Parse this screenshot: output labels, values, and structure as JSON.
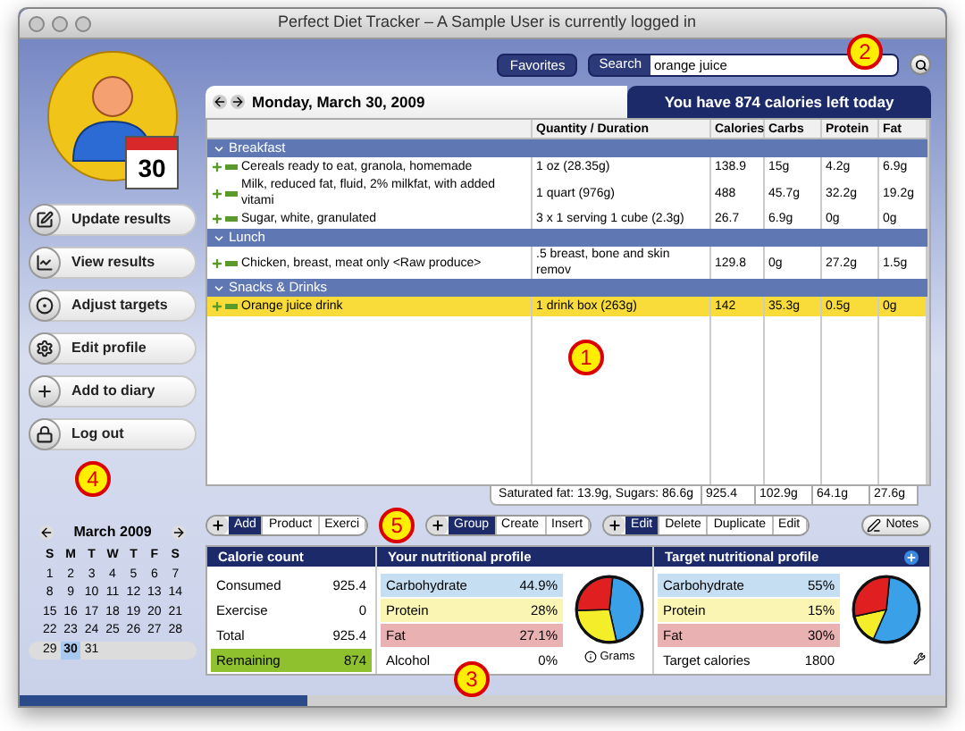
{
  "window": {
    "title": "Perfect Diet Tracker – A Sample User is currently logged in"
  },
  "calendar_badge": {
    "day": "30"
  },
  "toolbar": {
    "favorites": "Favorites",
    "search_label": "Search",
    "search_value": "orange juice"
  },
  "date_bar": {
    "date": "Monday, March 30, 2009",
    "banner": "You have 874 calories left today"
  },
  "table": {
    "columns": [
      "Quantity / Duration",
      "Calories",
      "Carbs",
      "Protein",
      "Fat"
    ],
    "groups": [
      {
        "name": "Breakfast",
        "rows": [
          {
            "food": "Cereals ready to eat, granola, homemade",
            "quantity": "1 oz (28.35g)",
            "calories": "138.9",
            "carbs": "15g",
            "protein": "4.2g",
            "fat": "6.9g",
            "selected": false
          },
          {
            "food": "Milk, reduced fat, fluid, 2% milkfat, with added vitami",
            "quantity": "1 quart (976g)",
            "calories": "488",
            "carbs": "45.7g",
            "protein": "32.2g",
            "fat": "19.2g",
            "selected": false
          },
          {
            "food": "Sugar, white, granulated",
            "quantity": "3 x 1 serving 1 cube (2.3g)",
            "calories": "26.7",
            "carbs": "6.9g",
            "protein": "0g",
            "fat": "0g",
            "selected": false
          }
        ]
      },
      {
        "name": "Lunch",
        "rows": [
          {
            "food": "Chicken, breast, meat only <Raw produce>",
            "quantity": ".5 breast, bone and skin remov",
            "calories": "129.8",
            "carbs": "0g",
            "protein": "27.2g",
            "fat": "1.5g",
            "selected": false
          }
        ]
      },
      {
        "name": "Snacks & Drinks",
        "rows": [
          {
            "food": "Orange juice drink",
            "quantity": "1 drink box (263g)",
            "calories": "142",
            "carbs": "35.3g",
            "protein": "0.5g",
            "fat": "0g",
            "selected": true
          }
        ]
      }
    ],
    "footer": {
      "summary": "Saturated fat: 13.9g, Sugars: 86.6g",
      "calories": "925.4",
      "carbs": "102.9g",
      "protein": "64.1g",
      "fat": "27.6g"
    }
  },
  "sidebar": {
    "buttons": [
      {
        "label": "Update results"
      },
      {
        "label": "View results"
      },
      {
        "label": "Adjust targets"
      },
      {
        "label": "Edit profile"
      },
      {
        "label": "Add to diary"
      },
      {
        "label": "Log out"
      }
    ]
  },
  "calendar": {
    "month": "March 2009",
    "weekdays": [
      "S",
      "M",
      "T",
      "W",
      "T",
      "F",
      "S"
    ],
    "weeks": [
      [
        {
          "day": "1",
          "selected": false
        },
        {
          "day": "2",
          "selected": false
        },
        {
          "day": "3",
          "selected": false
        },
        {
          "day": "4",
          "selected": false
        },
        {
          "day": "5",
          "selected": false
        },
        {
          "day": "6",
          "selected": false
        },
        {
          "day": "7",
          "selected": false
        }
      ],
      [
        {
          "day": "8",
          "selected": false
        },
        {
          "day": "9",
          "selected": false
        },
        {
          "day": "10",
          "selected": false
        },
        {
          "day": "11",
          "selected": false
        },
        {
          "day": "12",
          "selected": false
        },
        {
          "day": "13",
          "selected": false
        },
        {
          "day": "14",
          "selected": false
        }
      ],
      [
        {
          "day": "15",
          "selected": false
        },
        {
          "day": "16",
          "selected": false
        },
        {
          "day": "17",
          "selected": false
        },
        {
          "day": "18",
          "selected": false
        },
        {
          "day": "19",
          "selected": false
        },
        {
          "day": "20",
          "selected": false
        },
        {
          "day": "21",
          "selected": false
        }
      ],
      [
        {
          "day": "22",
          "selected": false
        },
        {
          "day": "23",
          "selected": false
        },
        {
          "day": "24",
          "selected": false
        },
        {
          "day": "25",
          "selected": false
        },
        {
          "day": "26",
          "selected": false
        },
        {
          "day": "27",
          "selected": false
        },
        {
          "day": "28",
          "selected": false
        }
      ],
      [
        {
          "day": "29",
          "selected": false
        },
        {
          "day": "30",
          "selected": true
        },
        {
          "day": "31",
          "selected": false
        }
      ]
    ],
    "progress": {
      "level": 0.31
    }
  },
  "action_groups": [
    [
      {
        "label": "Add",
        "selected": true
      },
      {
        "label": "Product",
        "selected": false
      },
      {
        "label": "Exerci",
        "selected": false
      }
    ],
    [
      {
        "label": "Group",
        "selected": true
      },
      {
        "label": "Create",
        "selected": false
      },
      {
        "label": "Insert",
        "selected": false
      }
    ],
    [
      {
        "label": "Edit",
        "selected": true
      },
      {
        "label": "Delete",
        "selected": false
      },
      {
        "label": "Duplicate",
        "selected": false
      },
      {
        "label": "Edit",
        "selected": false
      }
    ]
  ],
  "notes": "Notes",
  "calorie_count": {
    "title": "Calorie count",
    "rows": [
      {
        "label": "Consumed",
        "value": "925.4",
        "kind": "plain"
      },
      {
        "label": "Exercise",
        "value": "0",
        "kind": "plain"
      },
      {
        "label": "Total",
        "value": "925.4",
        "kind": "plain"
      },
      {
        "label": "Remaining",
        "value": "874",
        "kind": "remaining"
      }
    ]
  },
  "your_profile": {
    "title": "Your nutritional profile",
    "rows": [
      {
        "label": "Carbohydrate",
        "value": "44.9%",
        "color": "#c6def2"
      },
      {
        "label": "Protein",
        "value": "28%",
        "color": "#fbf5b4"
      },
      {
        "label": "Fat",
        "value": "27.1%",
        "color": "#eab1b3"
      },
      {
        "label": "Alcohol",
        "value": "0%",
        "color": "#ffffff"
      }
    ],
    "link": "Grams"
  },
  "target_profile": {
    "title": "Target nutritional profile",
    "rows": [
      {
        "label": "Carbohydrate",
        "value": "55%",
        "color": "#c6def2"
      },
      {
        "label": "Protein",
        "value": "15%",
        "color": "#fbf5b4"
      },
      {
        "label": "Fat",
        "value": "30%",
        "color": "#eab1b3"
      }
    ],
    "calories_label": "Target calories",
    "calories_value": "1800"
  },
  "callouts": [
    {
      "number": "1"
    },
    {
      "number": "2"
    },
    {
      "number": "3"
    },
    {
      "number": "4"
    },
    {
      "number": "5"
    }
  ]
}
